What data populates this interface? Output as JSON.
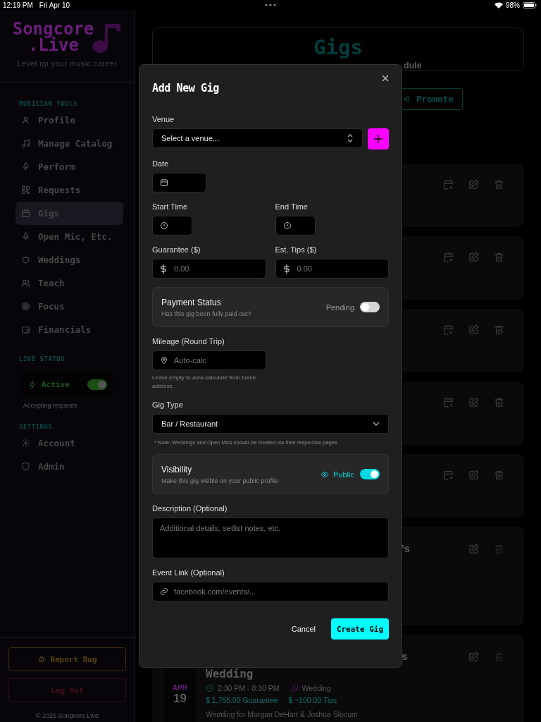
{
  "status_bar": {
    "time": "12:19 PM",
    "date": "Fri Apr 10",
    "battery": "98%"
  },
  "sidebar": {
    "logo": [
      "Songcore",
      ".Live"
    ],
    "tagline": "Level up your music career",
    "musician_tools": {
      "title": "MUSICIAN TOOLS",
      "items": [
        {
          "label": "Profile",
          "selected": false
        },
        {
          "label": "Manage Catalog",
          "selected": false
        },
        {
          "label": "Perform",
          "selected": false
        },
        {
          "label": "Requests",
          "selected": false
        },
        {
          "label": "Gigs",
          "selected": true
        },
        {
          "label": "Open Mic, Etc.",
          "selected": false
        },
        {
          "label": "Weddings",
          "selected": false
        },
        {
          "label": "Teach",
          "selected": false
        },
        {
          "label": "Focus",
          "selected": false
        },
        {
          "label": "Financials",
          "selected": false
        }
      ]
    },
    "live_status": {
      "title": "LIVE STATUS",
      "label": "Active",
      "on": true,
      "note": "Accepting requests"
    },
    "settings": {
      "title": "SETTINGS",
      "items": [
        {
          "label": "Account",
          "selected": false
        },
        {
          "label": "Admin",
          "selected": false
        }
      ]
    },
    "report_button": "Report Bug",
    "logout_button": "Log Out",
    "copyright": "© 2026 Songcore.Live"
  },
  "main": {
    "header": {
      "title": "Gigs",
      "subtitle_fragment": "dule"
    },
    "promote_button": "Promote",
    "gig_cards": [
      {
        "kind": "gig"
      },
      {
        "kind": "gig"
      },
      {
        "kind": "gig"
      },
      {
        "kind": "gig"
      },
      {
        "kind": "gig"
      },
      {
        "kind": "wedding",
        "title_fragment": "'s"
      },
      {
        "kind": "wedding",
        "title_fragment": "s",
        "title_end": "Wedding",
        "month": "APR",
        "day": "19",
        "time": "2:30 PM - 8:30 PM",
        "type": "Wedding",
        "guarantee": "$ 1,755.00 Guarantee",
        "tips": "$ ~100.00 Tips",
        "description": "Wedding for Morgan DeHart & Joshua Slocum"
      }
    ]
  },
  "modal": {
    "title": "Add New Gig",
    "venue": {
      "label": "Venue",
      "value": "Select a venue..."
    },
    "date": {
      "label": "Date"
    },
    "start_time": {
      "label": "Start Time"
    },
    "end_time": {
      "label": "End Time"
    },
    "guarantee": {
      "label": "Guarantee ($)",
      "placeholder": "0.00"
    },
    "tips": {
      "label": "Est. Tips ($)",
      "placeholder": "0.00"
    },
    "payment": {
      "title": "Payment Status",
      "description": "Has this gig been fully paid out?",
      "status": "Pending",
      "on": false
    },
    "mileage": {
      "label": "Mileage (Round Trip)",
      "placeholder": "Auto-calc",
      "help": "Leave empty to auto-calculate from home address."
    },
    "gig_type": {
      "label": "Gig Type",
      "value": "Bar / Restaurant",
      "note": "* Note: Weddings and Open Mics should be created via their respective pages."
    },
    "visibility": {
      "title": "Visibility",
      "description": "Make this gig visible on your public profile",
      "status": "Public",
      "on": true
    },
    "description": {
      "label": "Description (Optional)",
      "placeholder": "Additional details, setlist notes, etc."
    },
    "event_link": {
      "label": "Event Link (Optional)",
      "placeholder": "facebook.com/events/..."
    },
    "cancel_button": "Cancel",
    "create_button": "Create Gig"
  }
}
